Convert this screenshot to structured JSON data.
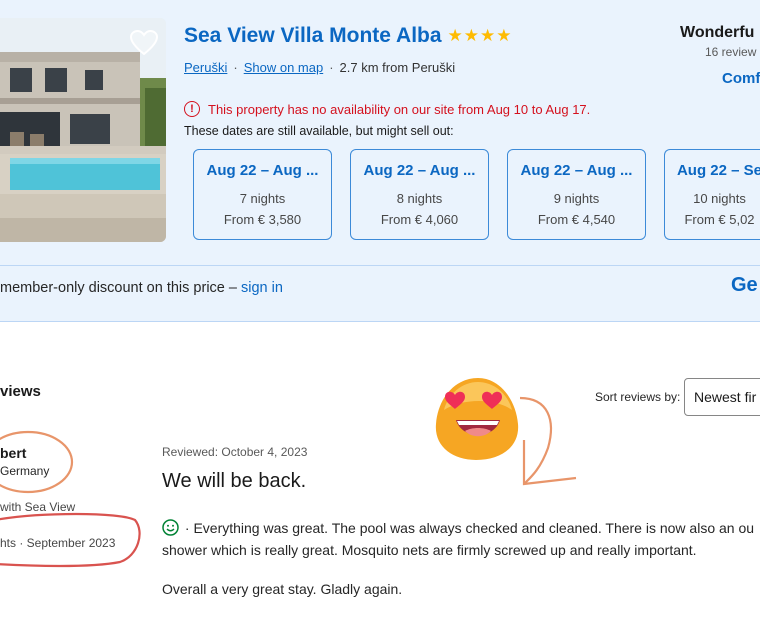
{
  "property": {
    "title": "Sea View Villa Monte Alba",
    "stars": "★★★★",
    "location_link": "Peruški",
    "map_link": "Show on map",
    "distance": "2.7 km from Peruški",
    "warning": "This property has no availability on our site from Aug 10 to Aug 17.",
    "available_note": "These dates are still available, but might sell out:",
    "date_options": [
      {
        "range": "Aug 22 – Aug ...",
        "nights": "7 nights",
        "price": "From € 3,580"
      },
      {
        "range": "Aug 22 – Aug ...",
        "nights": "8 nights",
        "price": "From € 4,060"
      },
      {
        "range": "Aug 22 – Aug ...",
        "nights": "9 nights",
        "price": "From € 4,540"
      },
      {
        "range": "Aug 22 – Se",
        "nights": "10 nights",
        "price": "From € 5,02"
      }
    ],
    "score_label": "Wonderfu",
    "review_count": "16 review",
    "score_sub": "Comf",
    "discount_text": "member-only discount on this price – ",
    "sign_in": "sign in",
    "get_button": "Ge"
  },
  "reviews": {
    "heading": "views",
    "sort_label": "Sort reviews by:",
    "sort_value": "Newest fir",
    "reviewer": {
      "name": "bert",
      "country": "Germany",
      "room": "with Sea View",
      "stay": "hts · September 2023"
    },
    "review": {
      "date": "Reviewed: October 4, 2023",
      "title": "We will be back.",
      "body": " · Everything was great. The pool was always checked and cleaned. There is now also an ou shower which is really great. Mosquito nets are firmly screwed up and really important.",
      "body2": "Overall a very great stay. Gladly again."
    }
  },
  "colors": {
    "brand_blue": "#0b67c2",
    "card_bg": "#eaf3fd",
    "warning_red": "#d4111e",
    "star_yellow": "#febb02",
    "annotation_orange": "#e8956a",
    "annotation_red": "#d9534f"
  }
}
